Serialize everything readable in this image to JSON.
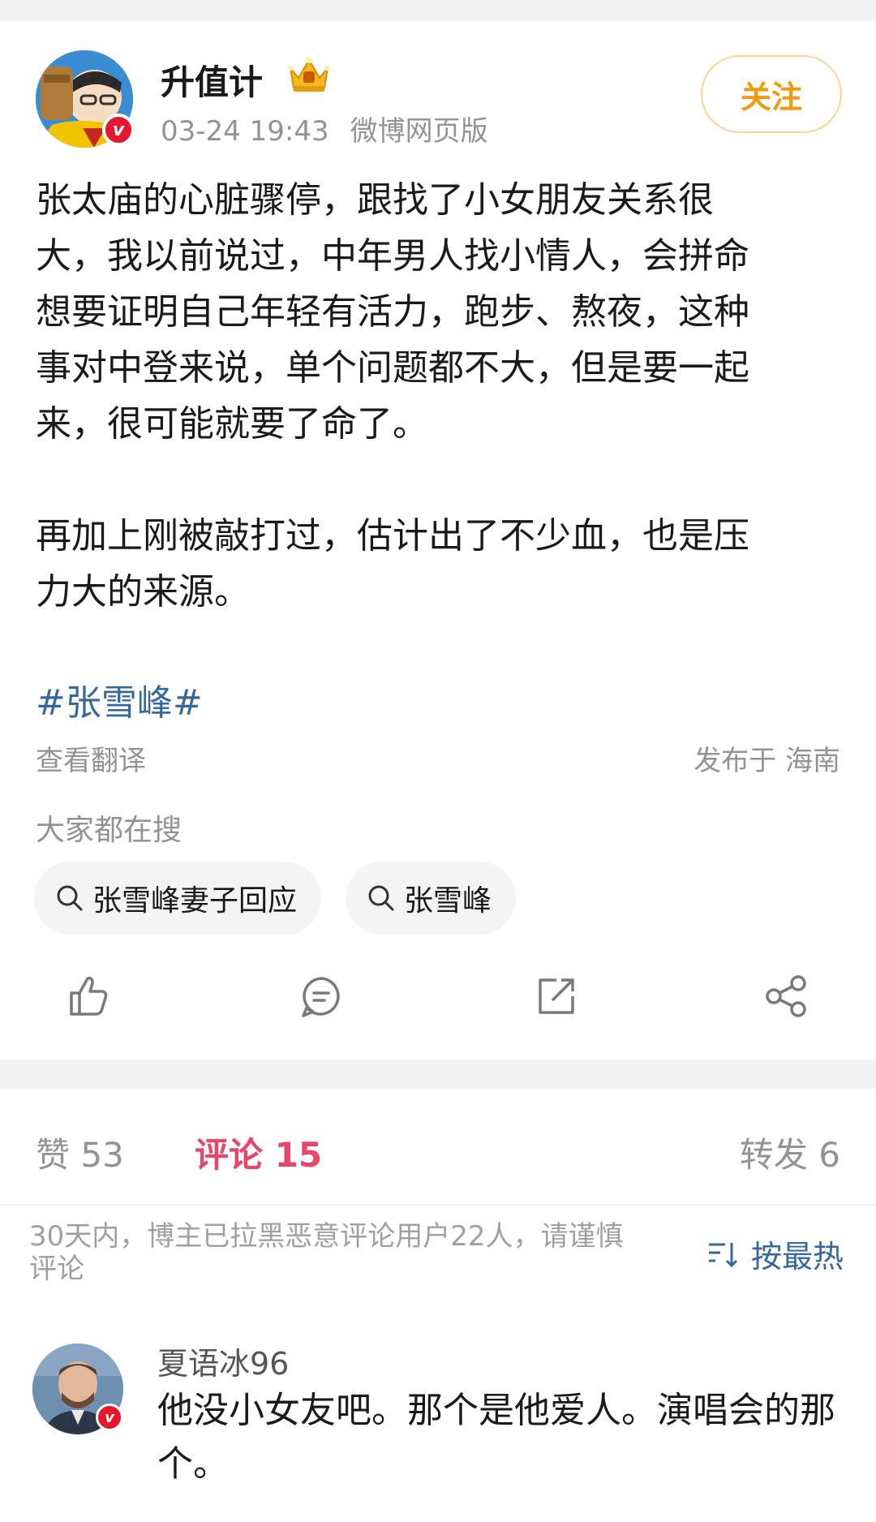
{
  "post": {
    "author": "升值计",
    "time": "03-24 19:43",
    "source": "微博网页版",
    "follow_label": "关注",
    "text": "张太庙的心脏骤停，跟找了小女朋友关系很\n大，我以前说过，中年男人找小情人，会拼命\n想要证明自己年轻有活力，跑步、熬夜，这种\n事对中登来说，单个问题都不大，但是要一起\n来，很可能就要了命了。\n\n再加上刚被敲打过，估计出了不少血，也是压\n力大的来源。",
    "hashtag": "#张雪峰#",
    "translate_label": "查看翻译",
    "location": "发布于 海南"
  },
  "search": {
    "title": "大家都在搜",
    "chips": [
      "张雪峰妻子回应",
      "张雪峰"
    ]
  },
  "actions": {
    "icons": [
      "like-icon",
      "comment-icon",
      "repost-icon",
      "share-icon"
    ]
  },
  "stats": {
    "like": "赞 53",
    "comment": "评论 15",
    "repost": "转发 6"
  },
  "comments_header": {
    "notice": "30天内，博主已拉黑恶意评论用户22人，请谨慎评论",
    "sort_label": "按最热"
  },
  "comments": [
    {
      "user": "夏语冰96",
      "text": "他没小女友吧。那个是他爱人。演唱会的那个。"
    }
  ],
  "colors": {
    "accent_orange": "#f19a0e",
    "link_blue": "#36699a",
    "comment_red": "#e8466b",
    "verified_red": "#e6162d",
    "muted_gray": "#939393"
  }
}
